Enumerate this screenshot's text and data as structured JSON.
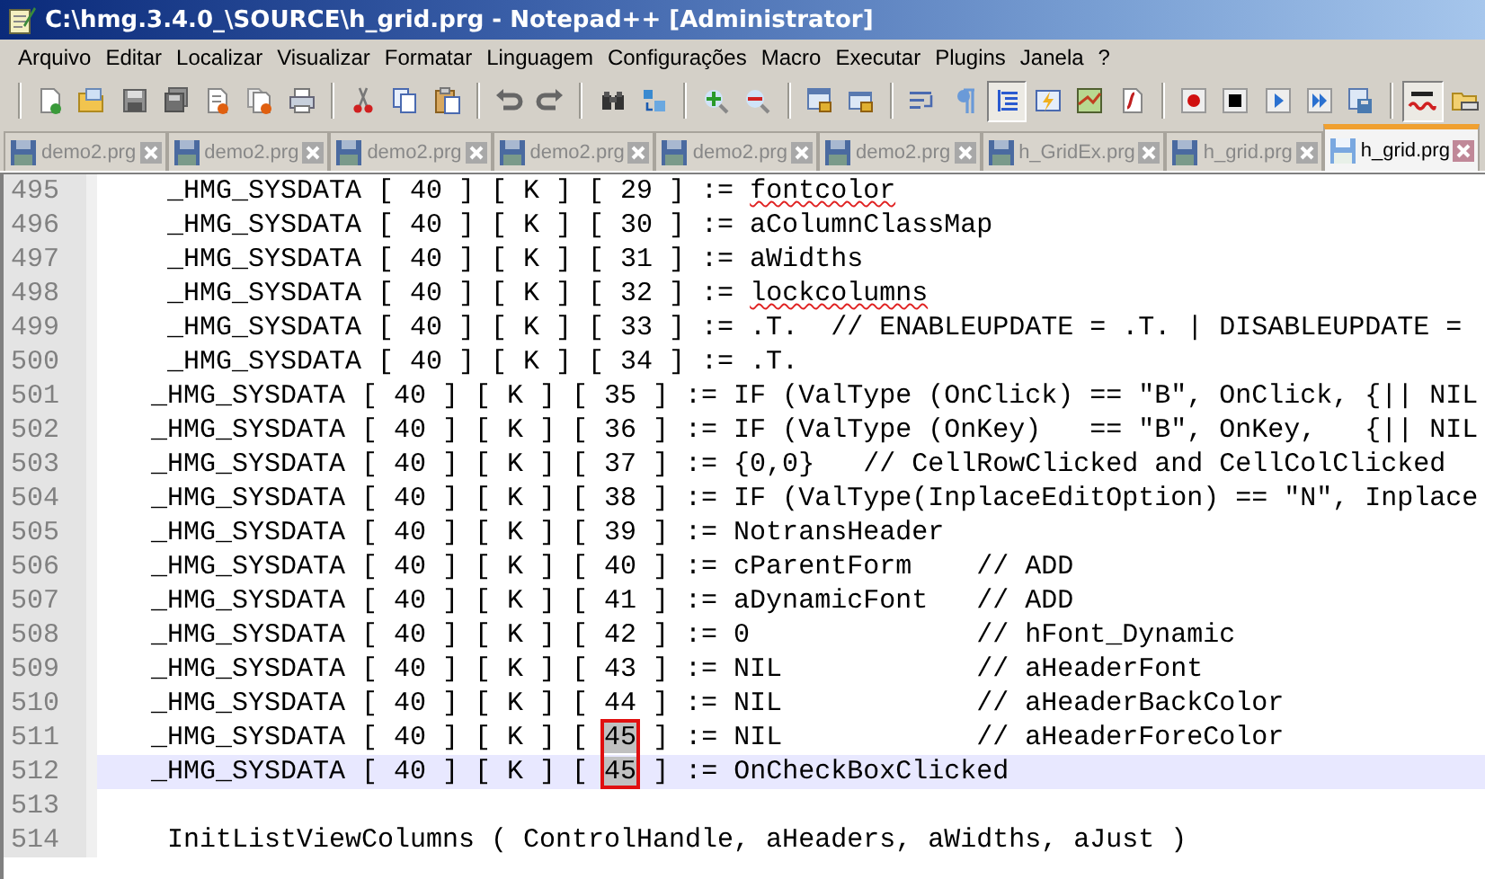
{
  "window": {
    "title": "C:\\hmg.3.4.0_\\SOURCE\\h_grid.prg - Notepad++ [Administrator]"
  },
  "menu": [
    "Arquivo",
    "Editar",
    "Localizar",
    "Visualizar",
    "Formatar",
    "Linguagem",
    "Configurações",
    "Macro",
    "Executar",
    "Plugins",
    "Janela",
    "?"
  ],
  "toolbar": [
    {
      "kind": "separator"
    },
    {
      "kind": "button",
      "pressed": false
    },
    {
      "kind": "button",
      "pressed": false
    },
    {
      "kind": "button",
      "pressed": false
    },
    {
      "kind": "button",
      "pressed": false
    },
    {
      "kind": "button",
      "pressed": false
    },
    {
      "kind": "button",
      "pressed": false
    },
    {
      "kind": "button",
      "pressed": false
    },
    {
      "kind": "separator"
    },
    {
      "kind": "button",
      "pressed": false
    },
    {
      "kind": "button",
      "pressed": false
    },
    {
      "kind": "button",
      "pressed": false
    },
    {
      "kind": "separator"
    },
    {
      "kind": "button",
      "pressed": false
    },
    {
      "kind": "button",
      "pressed": false
    },
    {
      "kind": "separator"
    },
    {
      "kind": "button",
      "pressed": false
    },
    {
      "kind": "button",
      "pressed": false
    },
    {
      "kind": "separator"
    },
    {
      "kind": "button",
      "pressed": false
    },
    {
      "kind": "button",
      "pressed": false
    },
    {
      "kind": "separator"
    },
    {
      "kind": "button",
      "pressed": false
    },
    {
      "kind": "button",
      "pressed": false
    },
    {
      "kind": "separator"
    },
    {
      "kind": "button",
      "pressed": false
    },
    {
      "kind": "button",
      "pressed": false
    },
    {
      "kind": "button",
      "pressed": true
    },
    {
      "kind": "button",
      "pressed": false
    },
    {
      "kind": "button",
      "pressed": false
    },
    {
      "kind": "button",
      "pressed": false
    },
    {
      "kind": "separator"
    },
    {
      "kind": "button",
      "pressed": false
    },
    {
      "kind": "button",
      "pressed": false
    },
    {
      "kind": "button",
      "pressed": false
    },
    {
      "kind": "button",
      "pressed": false
    },
    {
      "kind": "button",
      "pressed": false
    },
    {
      "kind": "separator"
    },
    {
      "kind": "button",
      "pressed": true
    },
    {
      "kind": "button",
      "pressed": false
    }
  ],
  "tabs": [
    {
      "label": "demo2.prg",
      "selected": false
    },
    {
      "label": "demo2.prg",
      "selected": false
    },
    {
      "label": "demo2.prg",
      "selected": false
    },
    {
      "label": "demo2.prg",
      "selected": false
    },
    {
      "label": "demo2.prg",
      "selected": false
    },
    {
      "label": "demo2.prg",
      "selected": false
    },
    {
      "label": "h_GridEx.prg",
      "selected": false
    },
    {
      "label": "h_grid.prg",
      "selected": false
    },
    {
      "label": "h_grid.prg",
      "selected": true
    }
  ],
  "editor": {
    "lines": [
      {
        "number": "495",
        "current": false,
        "segments": [
          {
            "kind": "plain",
            "text": "    _HMG_SYSDATA [ 40 ] [ K ] [ 29 ] := "
          },
          {
            "kind": "misspelled",
            "text": "fontcolor"
          }
        ]
      },
      {
        "number": "496",
        "current": false,
        "segments": [
          {
            "kind": "plain",
            "text": "    _HMG_SYSDATA [ 40 ] [ K ] [ 30 ] := aColumnClassMap"
          }
        ]
      },
      {
        "number": "497",
        "current": false,
        "segments": [
          {
            "kind": "plain",
            "text": "    _HMG_SYSDATA [ 40 ] [ K ] [ 31 ] := aWidths"
          }
        ]
      },
      {
        "number": "498",
        "current": false,
        "segments": [
          {
            "kind": "plain",
            "text": "    _HMG_SYSDATA [ 40 ] [ K ] [ 32 ] := "
          },
          {
            "kind": "misspelled",
            "text": "lockcolumns"
          }
        ]
      },
      {
        "number": "499",
        "current": false,
        "segments": [
          {
            "kind": "plain",
            "text": "    _HMG_SYSDATA [ 40 ] [ K ] [ 33 ] := .T.  // ENABLEUPDATE = .T. | DISABLEUPDATE ="
          }
        ]
      },
      {
        "number": "500",
        "current": false,
        "segments": [
          {
            "kind": "plain",
            "text": "    _HMG_SYSDATA [ 40 ] [ K ] [ 34 ] := .T."
          }
        ]
      },
      {
        "number": "501",
        "current": false,
        "segments": [
          {
            "kind": "plain",
            "text": "   _HMG_SYSDATA [ 40 ] [ K ] [ 35 ] := IF (ValType (OnClick) == \"B\", OnClick, {|| NIL"
          }
        ]
      },
      {
        "number": "502",
        "current": false,
        "segments": [
          {
            "kind": "plain",
            "text": "   _HMG_SYSDATA [ 40 ] [ K ] [ 36 ] := IF (ValType (OnKey)   == \"B\", OnKey,   {|| NIL"
          }
        ]
      },
      {
        "number": "503",
        "current": false,
        "segments": [
          {
            "kind": "plain",
            "text": "   _HMG_SYSDATA [ 40 ] [ K ] [ 37 ] := {0,0}   // CellRowClicked and CellColClicked"
          }
        ]
      },
      {
        "number": "504",
        "current": false,
        "segments": [
          {
            "kind": "plain",
            "text": "   _HMG_SYSDATA [ 40 ] [ K ] [ 38 ] := IF (ValType(InplaceEditOption) == \"N\", Inplace"
          }
        ]
      },
      {
        "number": "505",
        "current": false,
        "segments": [
          {
            "kind": "plain",
            "text": "   _HMG_SYSDATA [ 40 ] [ K ] [ 39 ] := NotransHeader"
          }
        ]
      },
      {
        "number": "506",
        "current": false,
        "segments": [
          {
            "kind": "plain",
            "text": "   _HMG_SYSDATA [ 40 ] [ K ] [ 40 ] := cParentForm    // ADD"
          }
        ]
      },
      {
        "number": "507",
        "current": false,
        "segments": [
          {
            "kind": "plain",
            "text": "   _HMG_SYSDATA [ 40 ] [ K ] [ 41 ] := aDynamicFont   // ADD"
          }
        ]
      },
      {
        "number": "508",
        "current": false,
        "segments": [
          {
            "kind": "plain",
            "text": "   _HMG_SYSDATA [ 40 ] [ K ] [ 42 ] := 0              // hFont_Dynamic"
          }
        ]
      },
      {
        "number": "509",
        "current": false,
        "segments": [
          {
            "kind": "plain",
            "text": "   _HMG_SYSDATA [ 40 ] [ K ] [ 43 ] := NIL            // aHeaderFont"
          }
        ]
      },
      {
        "number": "510",
        "current": false,
        "segments": [
          {
            "kind": "plain",
            "text": "   _HMG_SYSDATA [ 40 ] [ K ] [ 44 ] := NIL            // aHeaderBackColor"
          }
        ]
      },
      {
        "number": "511",
        "current": false,
        "segments": [
          {
            "kind": "plain",
            "text": "   _HMG_SYSDATA [ 40 ] [ K ] [ "
          },
          {
            "kind": "match",
            "text": "45"
          },
          {
            "kind": "plain",
            "text": " ] := NIL            // aHeaderForeColor"
          }
        ]
      },
      {
        "number": "512",
        "current": true,
        "segments": [
          {
            "kind": "plain",
            "text": "   _HMG_SYSDATA [ 40 ] [ K ] [ "
          },
          {
            "kind": "match",
            "text": "45"
          },
          {
            "kind": "plain",
            "text": " ] := OnCheckBoxClicked"
          }
        ]
      },
      {
        "number": "513",
        "current": false
      },
      {
        "number": "514",
        "current": false,
        "segments": [
          {
            "kind": "plain",
            "text": "    InitListViewColumns ( ControlHandle, aHeaders, aWidths, aJust )"
          }
        ]
      }
    ]
  }
}
